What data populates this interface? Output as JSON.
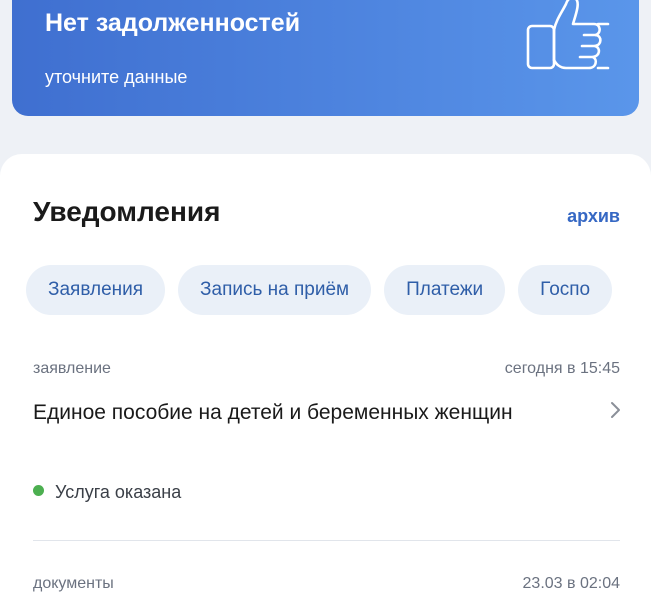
{
  "banner": {
    "title": "Нет задолженностей",
    "subtitle": "уточните данные",
    "icon": "thumbs-up-icon",
    "gradient": [
      "#3f6fd0",
      "#5a96ea"
    ]
  },
  "notifications": {
    "title": "Уведомления",
    "archive_label": "архив",
    "chips": [
      {
        "label": "Заявления"
      },
      {
        "label": "Запись на приём"
      },
      {
        "label": "Платежи"
      },
      {
        "label": "Госпо"
      }
    ],
    "items": [
      {
        "category": "заявление",
        "time": "сегодня в 15:45",
        "title": "Единое пособие на детей и беременных женщин",
        "status": "Услуга оказана",
        "status_color": "#4caf50"
      },
      {
        "category": "документы",
        "time": "23.03 в 02:04"
      }
    ]
  },
  "colors": {
    "accent": "#3668c4",
    "chip_bg": "#eaf0f8",
    "page_bg": "#eef1f6"
  }
}
